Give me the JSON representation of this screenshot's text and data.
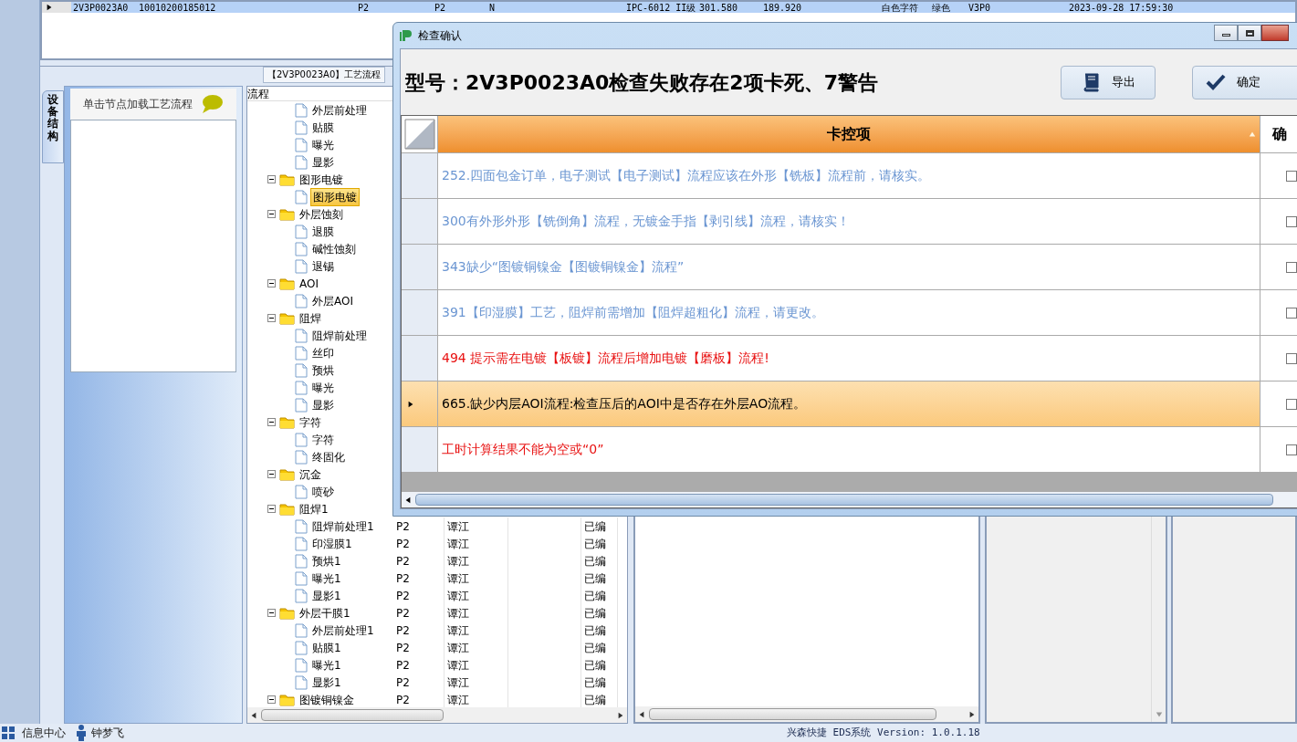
{
  "top_grid": {
    "rows": [
      {
        "selected": true,
        "cells": [
          "2V3P0023A0",
          "10010200185012",
          "P2",
          "P2",
          "N",
          "IPC-6012 II级",
          "301.580",
          "189.920",
          "白色字符",
          "绿色",
          "V3P0",
          "2023-09-28 17:59:30"
        ]
      }
    ]
  },
  "left_panel": {
    "vertical_tab": "设备结构",
    "hint": "单击节点加载工艺流程"
  },
  "flow_panel": {
    "tab": "【2V3P0023A0】工艺流程",
    "tree_header": "流程",
    "groups": [
      {
        "children": [
          {
            "label": "外层前处理",
            "selected": false
          },
          {
            "label": "贴膜",
            "selected": false
          },
          {
            "label": "曝光",
            "selected": false
          },
          {
            "label": "显影",
            "selected": false
          }
        ]
      },
      {
        "label": "图形电镀",
        "expanded": true,
        "children": [
          {
            "label": "图形电镀",
            "selected": true
          }
        ]
      },
      {
        "label": "外层蚀刻",
        "expanded": true,
        "children": [
          {
            "label": "退膜",
            "selected": false
          },
          {
            "label": "碱性蚀刻",
            "selected": false
          },
          {
            "label": "退锡",
            "selected": false
          }
        ]
      },
      {
        "label": "AOI",
        "expanded": true,
        "children": [
          {
            "label": "外层AOI",
            "selected": false
          }
        ]
      },
      {
        "label": "阻焊",
        "expanded": true,
        "children": [
          {
            "label": "阻焊前处理",
            "selected": false
          },
          {
            "label": "丝印",
            "selected": false
          },
          {
            "label": "预烘",
            "selected": false
          },
          {
            "label": "曝光",
            "selected": false
          },
          {
            "label": "显影",
            "selected": false
          }
        ]
      },
      {
        "label": "字符",
        "expanded": true,
        "children": [
          {
            "label": "字符",
            "selected": false
          },
          {
            "label": "终固化",
            "selected": false
          }
        ]
      },
      {
        "label": "沉金",
        "expanded": true,
        "children": [
          {
            "label": "喷砂",
            "selected": false
          }
        ]
      },
      {
        "label": "阻焊1",
        "expanded": true,
        "children": [
          {
            "label": "阻焊前处理1",
            "selected": false,
            "cells": [
              "P2",
              "谭江",
              "",
              "已编"
            ]
          },
          {
            "label": "印湿膜1",
            "selected": false,
            "cells": [
              "P2",
              "谭江",
              "",
              "已编"
            ]
          },
          {
            "label": "预烘1",
            "selected": false,
            "cells": [
              "P2",
              "谭江",
              "",
              "已编"
            ]
          },
          {
            "label": "曝光1",
            "selected": false,
            "cells": [
              "P2",
              "谭江",
              "",
              "已编"
            ]
          },
          {
            "label": "显影1",
            "selected": false,
            "cells": [
              "P2",
              "谭江",
              "",
              "已编"
            ]
          }
        ]
      },
      {
        "label": "外层干膜1",
        "expanded": true,
        "cells": [
          "P2",
          "谭江",
          "",
          "已编"
        ],
        "children": [
          {
            "label": "外层前处理1",
            "selected": false,
            "cells": [
              "P2",
              "谭江",
              "",
              "已编"
            ]
          },
          {
            "label": "贴膜1",
            "selected": false,
            "cells": [
              "P2",
              "谭江",
              "",
              "已编"
            ]
          },
          {
            "label": "曝光1",
            "selected": false,
            "cells": [
              "P2",
              "谭江",
              "",
              "已编"
            ]
          },
          {
            "label": "显影1",
            "selected": false,
            "cells": [
              "P2",
              "谭江",
              "",
              "已编"
            ]
          }
        ]
      },
      {
        "label": "图镀铜镍金",
        "expanded": true,
        "cells": [
          "P2",
          "谭江",
          "",
          "已编"
        ]
      }
    ]
  },
  "dialog": {
    "title": "检查确认",
    "heading": "型号：2V3P0023A0检查失败存在2项卡死、7警告",
    "buttons": [
      {
        "kind": "export",
        "label": "导出"
      },
      {
        "kind": "confirm",
        "label": "确定"
      }
    ],
    "columns": [
      "卡控项",
      "确"
    ],
    "rows": [
      {
        "kind": "warning",
        "text": "252.四面包金订单，电子测试【电子测试】流程应该在外形【铣板】流程前，请核实。",
        "selected": false,
        "checked": false
      },
      {
        "kind": "warning",
        "text": "300有外形外形【铣倒角】流程，无镀金手指【剥引线】流程，请核实！",
        "selected": false,
        "checked": false
      },
      {
        "kind": "warning",
        "text": "343缺少“图镀铜镍金【图镀铜镍金】流程”",
        "selected": false,
        "checked": false
      },
      {
        "kind": "warning",
        "text": "391【印湿膜】工艺，阻焊前需增加【阻焊超粗化】流程，请更改。",
        "selected": false,
        "checked": false
      },
      {
        "kind": "error",
        "text": "494 提示需在电镀【板镀】流程后增加电镀【磨板】流程!",
        "selected": false,
        "checked": false
      },
      {
        "kind": "warning",
        "text": "665.缺少内层AOI流程:检查压后的AOI中是否存在外层AO流程。",
        "selected": true,
        "checked": false
      },
      {
        "kind": "error",
        "text": "工时计算结果不能为空或“0”",
        "selected": false,
        "checked": false
      }
    ]
  },
  "status_bar": {
    "info": "信息中心",
    "user": "钟梦飞",
    "version": "兴森快捷 EDS系统 Version: 1.0.1.18"
  }
}
